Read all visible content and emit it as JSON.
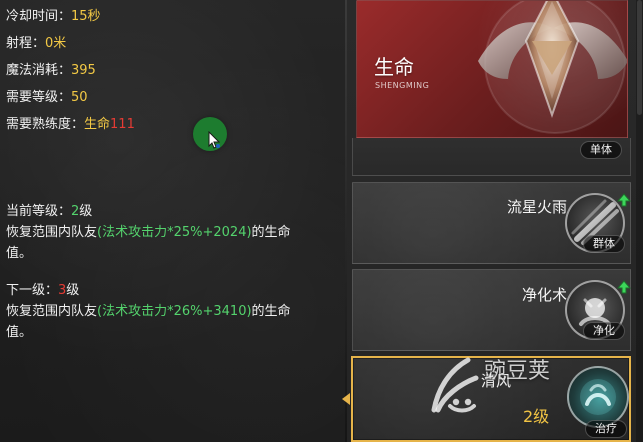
{
  "details": {
    "cooldown": {
      "label": "冷却时间：",
      "value": "15秒"
    },
    "range": {
      "label": "射程：",
      "value": "0米"
    },
    "mana_cost": {
      "label": "魔法消耗：",
      "value": "395"
    },
    "required_level": {
      "label": "需要等级：",
      "value": "50"
    },
    "required_proficiency": {
      "label": "需要熟练度：",
      "skill": "生命",
      "value": "111"
    },
    "current_level": {
      "label": "当前等级：",
      "level": "2",
      "level_unit": "级",
      "desc_prefix": "恢复范围内队友",
      "formula": "(法术攻击力*25%+2024)",
      "desc_suffix_1": "的生命",
      "desc_suffix_2": "值。"
    },
    "next_level": {
      "label": "下一级：",
      "level": "3",
      "level_unit": "级",
      "desc_prefix": "恢复范围内队友",
      "formula": "(法术攻击力*26%+3410)",
      "desc_suffix_1": "的生命",
      "desc_suffix_2": "值。"
    }
  },
  "sidebar": {
    "header": {
      "title": "生命",
      "subtitle": "SHENGMING"
    },
    "partial_card": {
      "badge": "单体"
    },
    "skills": [
      {
        "name": "流星火雨",
        "badge": "群体",
        "icon": "meteor-shower-icon"
      },
      {
        "name": "净化术",
        "badge": "净化",
        "icon": "purify-icon"
      }
    ],
    "selected": {
      "name": "清风",
      "level": "2级",
      "badge": "治疗",
      "icon": "heal-icon"
    }
  },
  "watermark": {
    "text": "豌豆荚"
  },
  "colors": {
    "yellow": "#f3c945",
    "red": "#e53b34",
    "green": "#54d36d",
    "selected_border": "#e6b44a"
  }
}
